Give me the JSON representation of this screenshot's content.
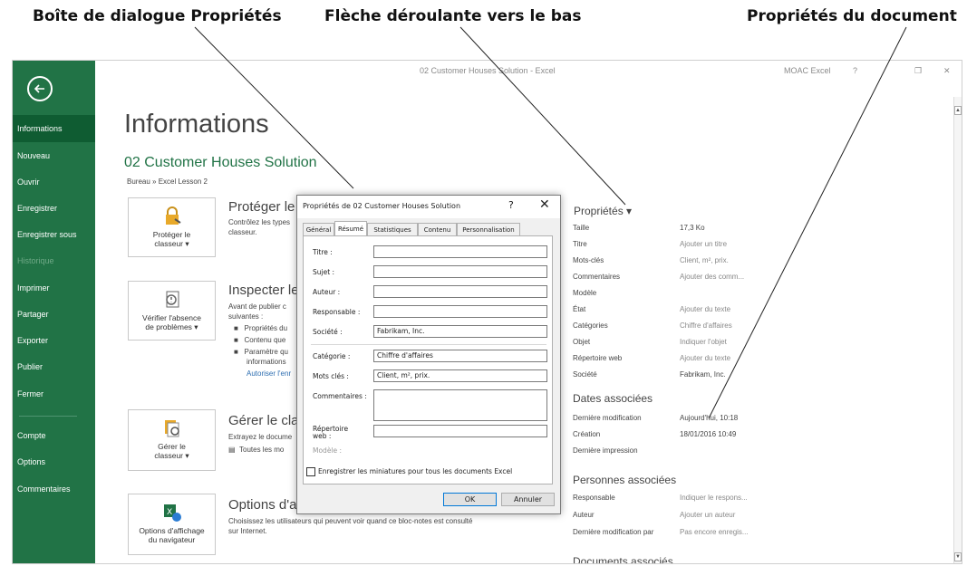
{
  "annotations": {
    "dialog": "Boîte de dialogue Propriétés",
    "dropdown_arrow": "Flèche déroulante vers le bas",
    "doc_props": "Propriétés du document"
  },
  "titlebar": {
    "title": "02 Customer Houses Solution - Excel",
    "account": "MOAC Excel",
    "help": "?",
    "restore": "❐",
    "close": "✕"
  },
  "sidebar": {
    "items": [
      {
        "label": "Informations"
      },
      {
        "label": "Nouveau"
      },
      {
        "label": "Ouvrir"
      },
      {
        "label": "Enregistrer"
      },
      {
        "label": "Enregistrer sous"
      },
      {
        "label": "Historique"
      },
      {
        "label": "Imprimer"
      },
      {
        "label": "Partager"
      },
      {
        "label": "Exporter"
      },
      {
        "label": "Publier"
      },
      {
        "label": "Fermer"
      },
      {
        "label": "Compte"
      },
      {
        "label": "Options"
      },
      {
        "label": "Commentaires"
      }
    ]
  },
  "main": {
    "page_title": "Informations",
    "doc_title": "02 Customer Houses Solution",
    "breadcrumb": "Bureau » Excel Lesson 2",
    "protect": {
      "tile_line1": "Protéger le",
      "tile_line2": "classeur ▾",
      "heading": "Protéger le c",
      "text1": "Contrôlez les types",
      "text2": "classeur."
    },
    "inspect": {
      "tile_line1": "Vérifier l'absence",
      "tile_line2": "de problèmes ▾",
      "heading": "Inspecter le",
      "text1": "Avant de publier c",
      "text2": "suivantes :",
      "b1": "Propriétés du",
      "b2": "Contenu que",
      "b3": "Paramètre qu",
      "b3b": "informations",
      "link": "Autoriser l'enr"
    },
    "manage": {
      "tile_line1": "Gérer le",
      "tile_line2": "classeur ▾",
      "heading": "Gérer le clas",
      "text1": "Extrayez le docume",
      "text2": "Toutes les mo"
    },
    "browser": {
      "tile_line1": "Options d'affichage",
      "tile_line2": "du navigateur",
      "heading": "Options d'af",
      "text1": "Choisissez les utilisateurs qui peuvent voir quand ce bloc-notes est consulté",
      "text2": "sur Internet."
    }
  },
  "properties": {
    "heading": "Propriétés ▾",
    "rows": [
      {
        "label": "Taille",
        "value": "17,3 Ko",
        "muted": false
      },
      {
        "label": "Titre",
        "value": "Ajouter un titre",
        "muted": true
      },
      {
        "label": "Mots-clés",
        "value": "Client, m², prix.",
        "muted": true
      },
      {
        "label": "Commentaires",
        "value": "Ajouter des comm...",
        "muted": true
      },
      {
        "label": "Modèle",
        "value": "",
        "muted": true
      },
      {
        "label": "État",
        "value": "Ajouter du texte",
        "muted": true
      },
      {
        "label": "Catégories",
        "value": "Chiffre d'affaires",
        "muted": true
      },
      {
        "label": "Objet",
        "value": "Indiquer l'objet",
        "muted": true
      },
      {
        "label": "Répertoire web",
        "value": "Ajouter du texte",
        "muted": true
      },
      {
        "label": "Société",
        "value": "Fabrikam, Inc.",
        "muted": false
      }
    ],
    "dates_heading": "Dates associées",
    "dates": [
      {
        "label": "Dernière modification",
        "value": "Aujourd'hui, 10:18"
      },
      {
        "label": "Création",
        "value": "18/01/2016 10:49"
      },
      {
        "label": "Dernière impression",
        "value": ""
      }
    ],
    "people_heading": "Personnes associées",
    "people": [
      {
        "label": "Responsable",
        "value": "Indiquer le respons..."
      },
      {
        "label": "Auteur",
        "value": "Ajouter un auteur"
      },
      {
        "label": "Dernière modification par",
        "value": "Pas encore enregis..."
      }
    ],
    "docs_heading": "Documents associés"
  },
  "dialog": {
    "title": "Propriétés de 02 Customer Houses Solution",
    "help": "?",
    "close": "✕",
    "tabs": [
      "Général",
      "Résumé",
      "Statistiques",
      "Contenu",
      "Personnalisation"
    ],
    "active_tab": "Résumé",
    "fields": {
      "titre": {
        "label": "Titre :",
        "value": ""
      },
      "sujet": {
        "label": "Sujet :",
        "value": ""
      },
      "auteur": {
        "label": "Auteur :",
        "value": ""
      },
      "responsable": {
        "label": "Responsable :",
        "value": ""
      },
      "societe": {
        "label": "Société :",
        "value": "Fabrikam, Inc."
      },
      "categorie": {
        "label": "Catégorie :",
        "value": "Chiffre d'affaires"
      },
      "mots_cles": {
        "label": "Mots clés :",
        "value": "Client, m², prix."
      },
      "commentaires": {
        "label": "Commentaires :",
        "value": ""
      },
      "repertoire_l1": "Répertoire",
      "repertoire_l2": "web :",
      "repertoire_value": "",
      "modele": "Modèle :"
    },
    "checkbox": "Enregistrer les miniatures pour tous les documents Excel",
    "ok": "OK",
    "cancel": "Annuler"
  },
  "colors": {
    "sidebar": "#217346",
    "sidebar_active": "#0f5c32",
    "accent_green": "#217346",
    "link": "#2b6cb0"
  }
}
